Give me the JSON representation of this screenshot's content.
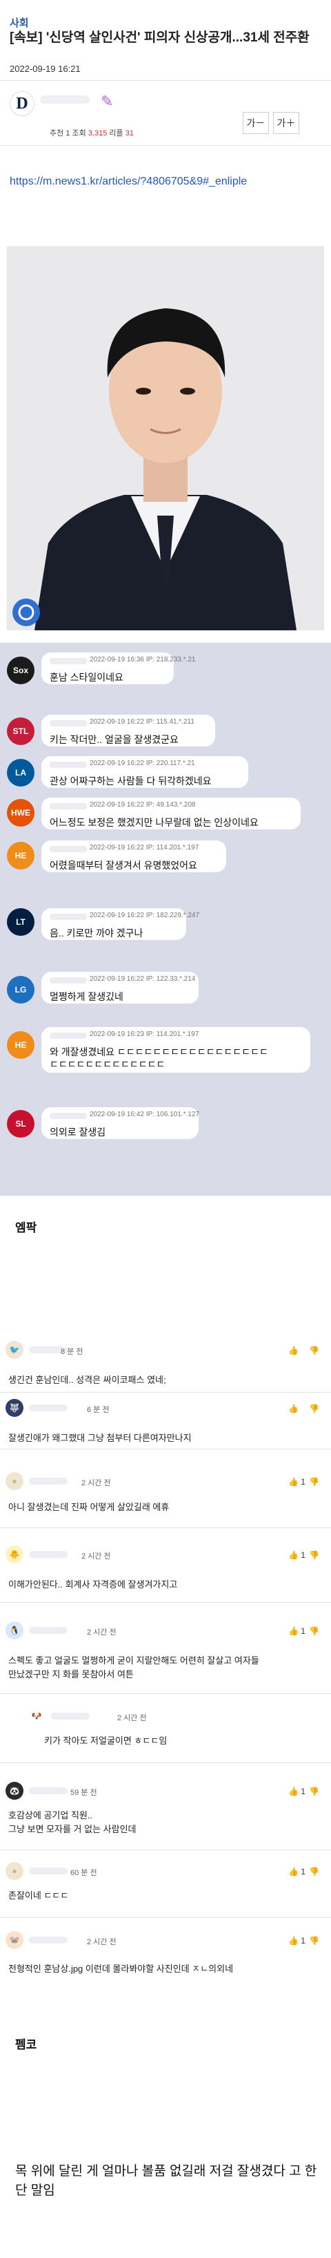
{
  "header": {
    "category": "사회",
    "title": "[속보] '신당역 살인사건' 피의자 신상공개...31세 전주환",
    "date": "2022-09-19 16:21",
    "team_logo_letter": "D",
    "stats": {
      "recommend_label": "추천",
      "recommend": "1",
      "views_label": "조회",
      "views": "3,315",
      "replies_label": "리플",
      "replies": "31"
    },
    "font_buttons": [
      "가－",
      "가＋"
    ]
  },
  "article": {
    "link": "https://m.news1.kr/articles/?4806705&9#_enliple"
  },
  "top_comments": [
    {
      "logo": "Sox",
      "color": "#1b1b1b",
      "meta": "2022-09-19 16:36  IP: 218.233.*.21",
      "text": "훈남 스타일이네요"
    },
    {
      "logo": "STL",
      "color": "#c41e3a",
      "meta": "2022-09-19 16:22  IP: 115.41.*.211",
      "text": "키는 작더만.. 얼굴을 잘생겼군요"
    },
    {
      "logo": "LA",
      "color": "#005a9c",
      "meta": "2022-09-19 16:22  IP: 220.117.*.21",
      "text": "관상 어짜구하는 사람들 다 뒤각하겠네요"
    },
    {
      "logo": "HWE",
      "color": "#e35205",
      "meta": "2022-09-19 16:22  IP: 49.143.*.208",
      "text": "어느정도 보정은 했겠지만 나무랄데 없는 인상이네요"
    },
    {
      "logo": "HE",
      "color": "#f08c1a",
      "meta": "2022-09-19 16:22  IP: 114.201.*.197",
      "text": "어렸을때부터 잘생겨서 유명했었어요"
    },
    {
      "logo": "LT",
      "color": "#041e42",
      "meta": "2022-09-19 16:22  IP: 182.229.*.247",
      "text": "음.. 키로만 까야 겠구나"
    },
    {
      "logo": "LG",
      "color": "#1d6fbf",
      "meta": "2022-09-19 16:22  IP: 122.33.*.214",
      "text": "멀쩡하게 잘생깄네"
    },
    {
      "logo": "HE",
      "color": "#f08c1a",
      "meta": "2022-09-19 16:23  IP: 114.201.*.197",
      "text": "와 개잘생겼네요 ㄷㄷㄷㄷㄷㄷㄷㄷㄷㄷㄷㄷㄷㄷㄷㄷㄷ",
      "text2": "ㄷㄷㄷㄷㄷㄷㄷㄷㄷㄷㄷㄷㄷ"
    },
    {
      "logo": "SL",
      "color": "#c8102e",
      "meta": "2022-09-19 16:42  IP: 106.101.*.127",
      "text": "의외로 잘생김"
    }
  ],
  "section1": "엠팍",
  "section_comments": [
    {
      "time": "8 분 전",
      "text": "생긴건 훈남인데.. 성격은 싸이코패스 였네;",
      "like": "",
      "avatar": "🐦",
      "av_bg": "#f1e6d4"
    },
    {
      "time": "6 분 전",
      "text": "잘생긴애가 왜그랬대 그냥 첨부터 다른여자만나지",
      "like": "",
      "avatar": "🐺",
      "av_bg": "#2c3e6e"
    },
    {
      "time": "2 시간 전",
      "text": "아니 잘생겼는데 진짜 어떻게 살았길래 에휴",
      "like": "1",
      "avatar": "●",
      "av_bg": "#efe6cf"
    },
    {
      "time": "2 시간 전",
      "text": "이해가안된다.. 회계사 자격증에 잘생겨가지고",
      "like": "1",
      "avatar": "🐥",
      "av_bg": "#fff3c4"
    },
    {
      "time": "2 시간 전",
      "text": "스펙도 좋고 얼굴도 멀쩡하게 굳이 지랄안해도 어련히 잘살고 여자들",
      "text2": "만났겠구만 지 화를 못참아서 여튼",
      "like": "1",
      "avatar": "🐧",
      "av_bg": "#d6e9ff"
    },
    {
      "time": "2 시간 전",
      "text": "키가 작아도 저얼굴이면 ㅎㄷㄷ임",
      "like": "",
      "avatar": "🐶",
      "av_bg": "#fff"
    },
    {
      "time": "59 분 전",
      "text": "호감상에 공기업 직원..",
      "text2": "그냥 보면 모자를 거 없는 사람인데",
      "like": "1",
      "avatar": "🐼",
      "av_bg": "#2b2b2b"
    },
    {
      "time": "60 분 전",
      "text": "존잘이네 ㄷㄷㄷ",
      "like": "1",
      "avatar": "●",
      "av_bg": "#efe6cf"
    },
    {
      "time": "2 시간 전",
      "text": "전형적인 훈남상.jpg 이런데 몰라봐야할 사진인데 ㅈㄴ의외네",
      "like": "1",
      "avatar": "🐭",
      "av_bg": "#fce3c8"
    }
  ],
  "section2": "펨코",
  "final_text": "목 위에 달린 게 얼마나 볼품 없길래 저걸 잘생겼다 고 한단 말임"
}
